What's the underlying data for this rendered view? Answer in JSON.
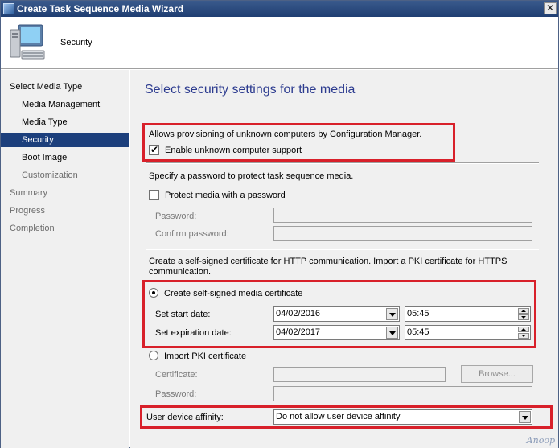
{
  "window": {
    "title": "Create Task Sequence Media Wizard",
    "close_glyph": "✕"
  },
  "header": {
    "title": "Security"
  },
  "nav": {
    "items": [
      {
        "label": "Select Media Type",
        "level": "top",
        "state": "normal"
      },
      {
        "label": "Media Management",
        "level": "sub",
        "state": "normal"
      },
      {
        "label": "Media Type",
        "level": "sub",
        "state": "normal"
      },
      {
        "label": "Security",
        "level": "sub",
        "state": "active"
      },
      {
        "label": "Boot Image",
        "level": "sub",
        "state": "normal"
      },
      {
        "label": "Customization",
        "level": "sub",
        "state": "disabled"
      },
      {
        "label": "Summary",
        "level": "top",
        "state": "disabled"
      },
      {
        "label": "Progress",
        "level": "top",
        "state": "disabled"
      },
      {
        "label": "Completion",
        "level": "top",
        "state": "disabled"
      }
    ]
  },
  "main": {
    "page_title": "Select security settings for the media",
    "unknown": {
      "description": "Allows provisioning of unknown computers by Configuration Manager.",
      "checkbox_label": "Enable unknown computer support",
      "checked": true
    },
    "password": {
      "description": "Specify a password to protect task sequence media.",
      "checkbox_label": "Protect media with a password",
      "checked": false,
      "password_label": "Password:",
      "confirm_label": "Confirm password:",
      "password_value": "",
      "confirm_value": ""
    },
    "certificate": {
      "description": "Create a self-signed certificate for HTTP communication. Import a PKI certificate for HTTPS communication.",
      "self_signed_label": "Create self-signed media certificate",
      "self_signed_selected": true,
      "start_label": "Set start date:",
      "start_date": "04/02/2016",
      "start_time": "05:45",
      "expiration_label": "Set expiration date:",
      "expiration_date": "04/02/2017",
      "expiration_time": "05:45",
      "pki_label": "Import PKI certificate",
      "pki_selected": false,
      "cert_label": "Certificate:",
      "cert_value": "",
      "browse_label": "Browse...",
      "pki_password_label": "Password:",
      "pki_password_value": ""
    },
    "affinity": {
      "label": "User device affinity:",
      "value": "Do not allow user device affinity"
    }
  },
  "watermark": "Anoop",
  "colors": {
    "highlight": "#d8202a",
    "nav_active": "#1c3f7c",
    "title_blue": "#2c3b8f"
  }
}
